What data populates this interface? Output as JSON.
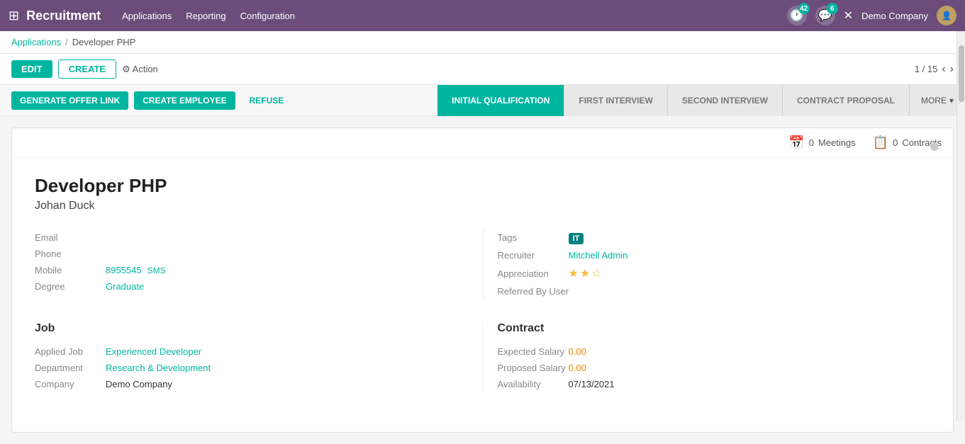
{
  "app": {
    "title": "Recruitment",
    "nav_links": [
      "Applications",
      "Reporting",
      "Configuration"
    ]
  },
  "header": {
    "notifications_count": "42",
    "messages_count": "6",
    "company": "Demo Company"
  },
  "breadcrumb": {
    "parent": "Applications",
    "separator": "/",
    "current": "Developer PHP"
  },
  "toolbar": {
    "edit_label": "EDIT",
    "create_label": "CREATE",
    "action_label": "⚙ Action",
    "pagination": "1 / 15"
  },
  "stage_bar": {
    "generate_offer_link": "GENERATE OFFER LINK",
    "create_employee": "CREATE EMPLOYEE",
    "refuse": "REFUSE",
    "stages": [
      {
        "id": "initial-qualification",
        "label": "INITIAL QUALIFICATION",
        "active": true
      },
      {
        "id": "first-interview",
        "label": "FIRST INTERVIEW",
        "active": false
      },
      {
        "id": "second-interview",
        "label": "SECOND INTERVIEW",
        "active": false
      },
      {
        "id": "contract-proposal",
        "label": "CONTRACT PROPOSAL",
        "active": false
      }
    ],
    "more_label": "MORE"
  },
  "record": {
    "title": "Developer PHP",
    "subtitle": "Johan Duck",
    "meetings": {
      "count": "0",
      "label": "Meetings"
    },
    "contracts": {
      "count": "0",
      "label": "Contracts"
    },
    "fields_left": [
      {
        "label": "Email",
        "value": "",
        "type": "text"
      },
      {
        "label": "Phone",
        "value": "",
        "type": "text"
      },
      {
        "label": "Mobile",
        "value": "8955545",
        "type": "link",
        "extra": "SMS"
      },
      {
        "label": "Degree",
        "value": "Graduate",
        "type": "link"
      }
    ],
    "fields_right": [
      {
        "label": "Tags",
        "value": "IT",
        "type": "tag"
      },
      {
        "label": "Recruiter",
        "value": "Mitchell Admin",
        "type": "link"
      },
      {
        "label": "Appreciation",
        "value": "★★☆",
        "type": "stars"
      },
      {
        "label": "Referred By User",
        "value": "",
        "type": "text"
      }
    ],
    "job_section": {
      "title": "Job",
      "fields": [
        {
          "label": "Applied Job",
          "value": "Experienced Developer",
          "type": "link"
        },
        {
          "label": "Department",
          "value": "Research & Development",
          "type": "link"
        },
        {
          "label": "Company",
          "value": "Demo Company",
          "type": "text"
        }
      ]
    },
    "contract_section": {
      "title": "Contract",
      "fields": [
        {
          "label": "Expected Salary",
          "value": "0.00",
          "type": "orange"
        },
        {
          "label": "Proposed Salary",
          "value": "0.00",
          "type": "orange"
        },
        {
          "label": "Availability",
          "value": "07/13/2021",
          "type": "text"
        }
      ]
    }
  }
}
